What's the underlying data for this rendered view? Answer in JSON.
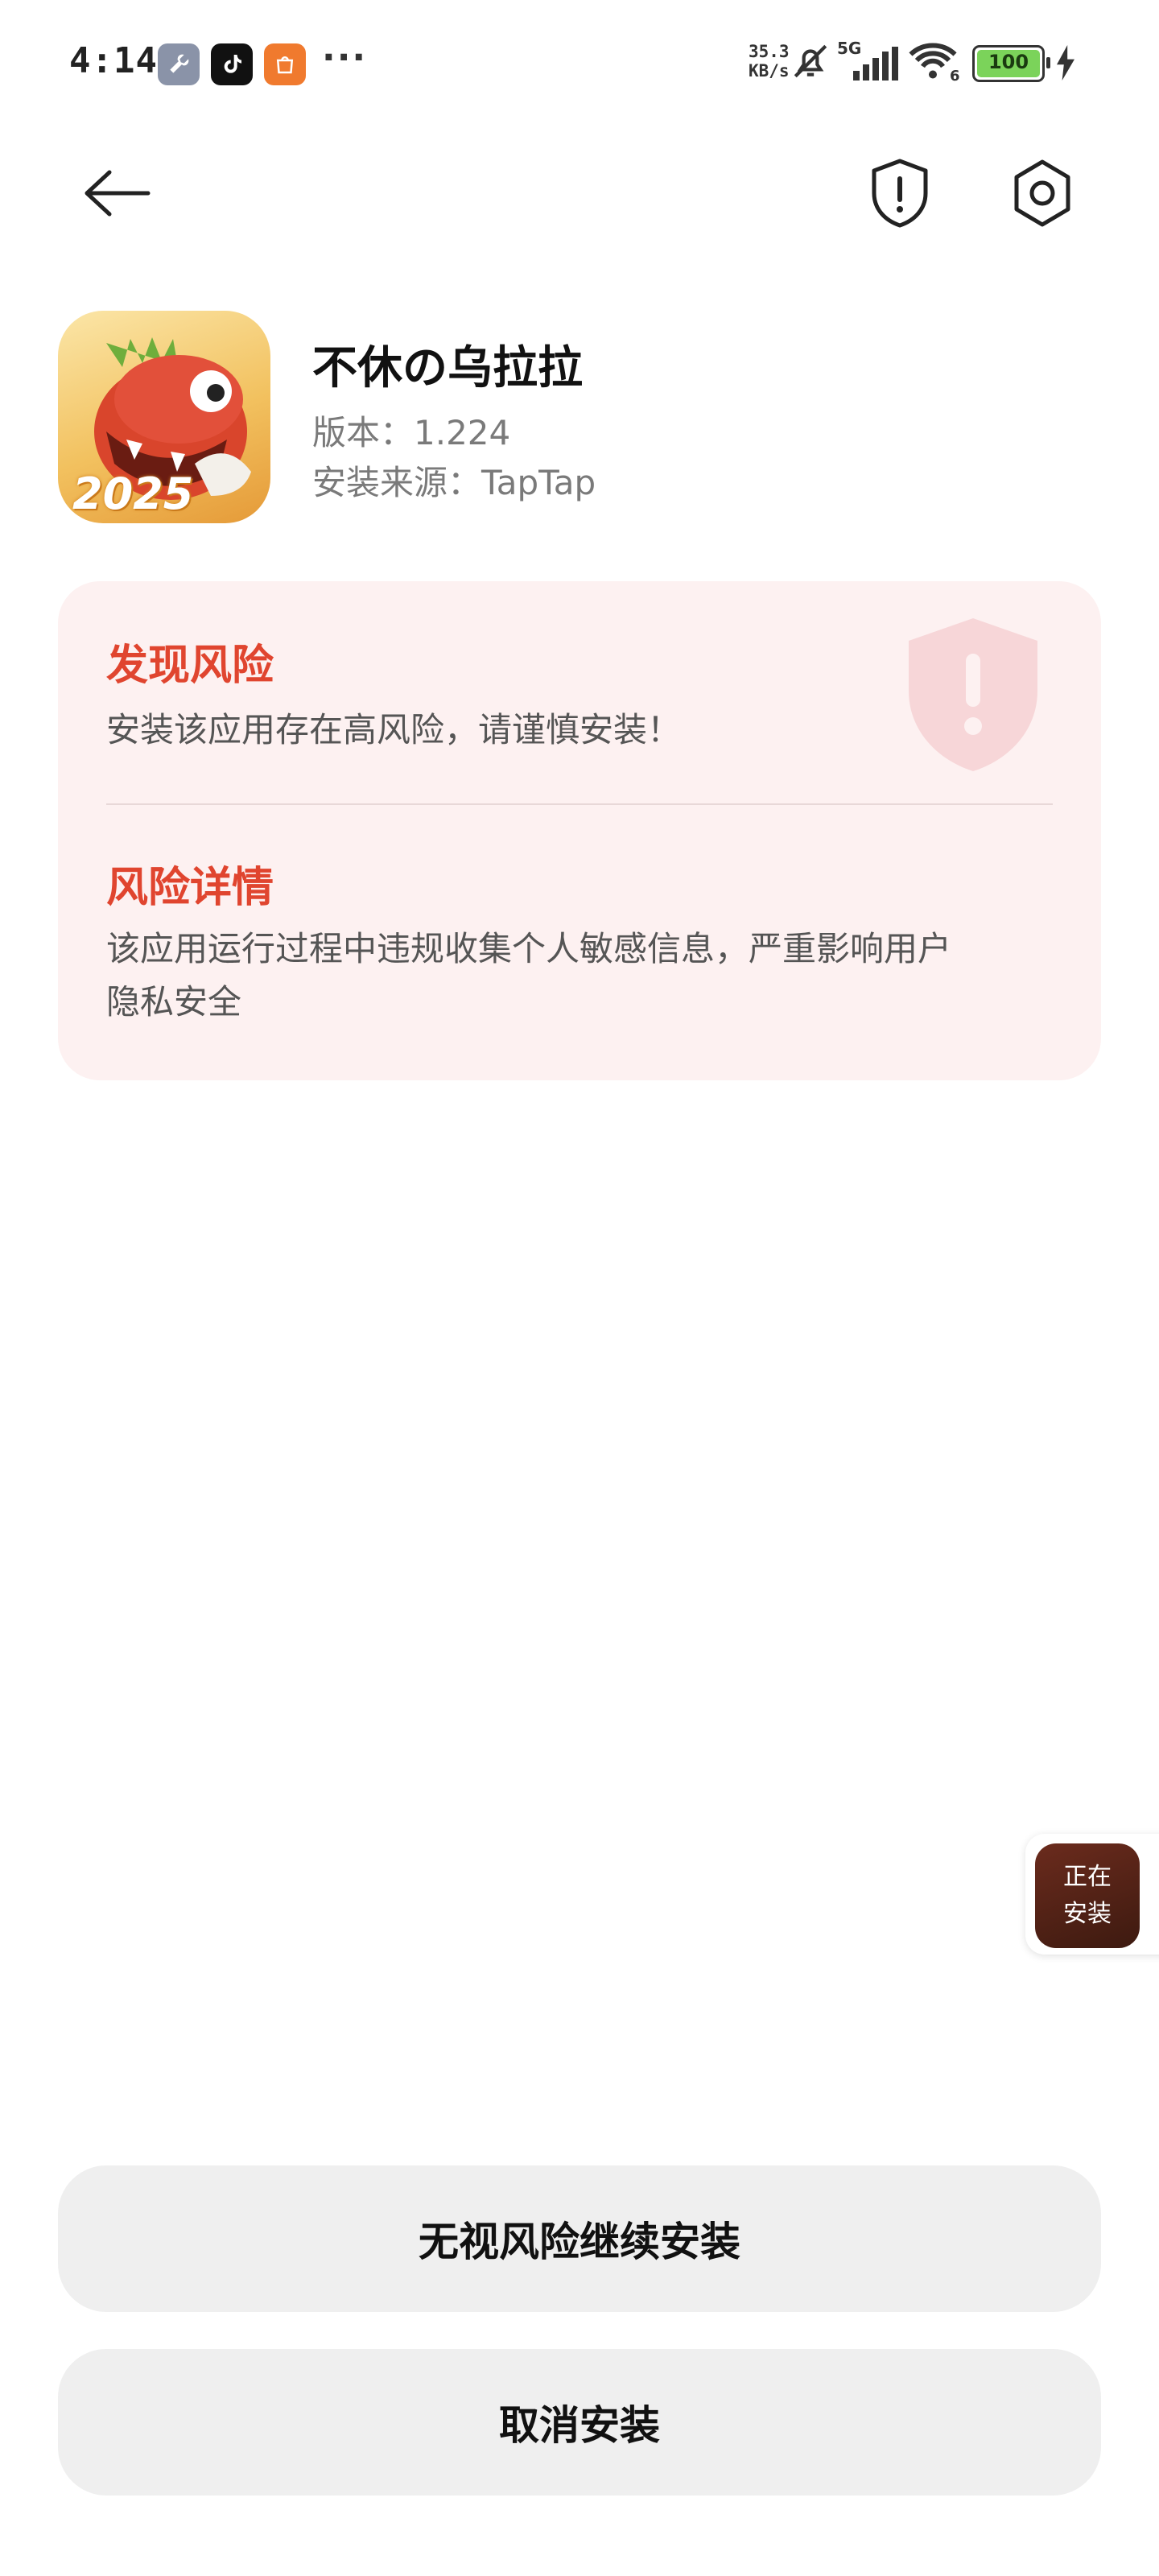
{
  "status_bar": {
    "time": "4:14",
    "more": "···",
    "net_speed_value": "35.3",
    "net_speed_unit": "KB/s",
    "network": "5G",
    "wifi_badge": "6",
    "battery": "100",
    "app_icons": [
      "wrench-icon",
      "tiktok-icon",
      "shop-icon"
    ],
    "icons": [
      "bell-muted-icon",
      "signal-icon",
      "wifi-icon",
      "battery-icon",
      "charging-icon"
    ]
  },
  "header": {
    "back_icon": "arrow-left-icon",
    "shield_icon": "shield-alert-icon",
    "settings_icon": "gear-icon"
  },
  "app": {
    "name": "不休の乌拉拉",
    "version_label": "版本：1.224",
    "source_label": "安装来源：TapTap",
    "icon_badge": "2025"
  },
  "risk": {
    "title": "发现风险",
    "message": "安装该应用存在高风险，请谨慎安装！",
    "detail_title": "风险详情",
    "detail_line1": "该应用运行过程中违规收集个人敏感信息，严重影响用户",
    "detail_line2": "隐私安全",
    "colors": {
      "accent": "#e0452f",
      "card_bg": "#fdf1f1"
    }
  },
  "floating": {
    "line1": "正在",
    "line2": "安装"
  },
  "actions": {
    "continue_label": "无视风险继续安装",
    "cancel_label": "取消安装"
  }
}
